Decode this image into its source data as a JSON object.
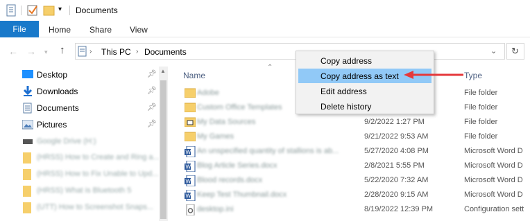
{
  "window": {
    "title": "Documents"
  },
  "ribbon": {
    "tabs": [
      "File",
      "Home",
      "Share",
      "View"
    ]
  },
  "address": {
    "crumbs": [
      "This PC",
      "Documents"
    ]
  },
  "nav": {
    "items": [
      {
        "label": "Desktop",
        "icon": "desktop-icon",
        "pinned": true
      },
      {
        "label": "Downloads",
        "icon": "downloads-icon",
        "pinned": true
      },
      {
        "label": "Documents",
        "icon": "documents-icon",
        "pinned": true
      },
      {
        "label": "Pictures",
        "icon": "pictures-icon",
        "pinned": true
      }
    ],
    "blurred": [
      "Google Drive (H:)",
      "(HRSS) How to Create and Ring a...",
      "(HRSS) How to Fix Unable to Upd...",
      "(HRSS) What is Bluetooth 5",
      "(UTT) How to Screenshot Snaps..."
    ]
  },
  "columns": {
    "name": "Name",
    "type": "Type"
  },
  "files": [
    {
      "name": "Adobe",
      "date": "",
      "type": "File folder",
      "icon": "folder"
    },
    {
      "name": "Custom Office Templates",
      "date": "",
      "type": "File folder",
      "icon": "folder"
    },
    {
      "name": "My Data Sources",
      "date": "9/2/2022 1:27 PM",
      "type": "File folder",
      "icon": "datasource"
    },
    {
      "name": "My Games",
      "date": "9/21/2022 9:53 AM",
      "type": "File folder",
      "icon": "folder"
    },
    {
      "name": "An unspecified quantity of stallions is ab...",
      "date": "5/27/2020 4:08 PM",
      "type": "Microsoft Word D",
      "icon": "word"
    },
    {
      "name": "Blog Article Series.docx",
      "date": "2/8/2021 5:55 PM",
      "type": "Microsoft Word D",
      "icon": "word"
    },
    {
      "name": "Blood records.docx",
      "date": "5/22/2020 7:32 AM",
      "type": "Microsoft Word D",
      "icon": "word"
    },
    {
      "name": "Keep Test Thumbnail.docx",
      "date": "2/28/2020 9:15 AM",
      "type": "Microsoft Word D",
      "icon": "word"
    },
    {
      "name": "desktop.ini",
      "date": "8/19/2022 12:39 PM",
      "type": "Configuration sett",
      "icon": "config"
    }
  ],
  "context_menu": {
    "items": [
      "Copy address",
      "Copy address as text",
      "Edit address",
      "Delete history"
    ],
    "selected": 1
  },
  "colors": {
    "accent": "#1979ca",
    "highlight": "#91c9f7",
    "arrow": "#e5383b"
  }
}
